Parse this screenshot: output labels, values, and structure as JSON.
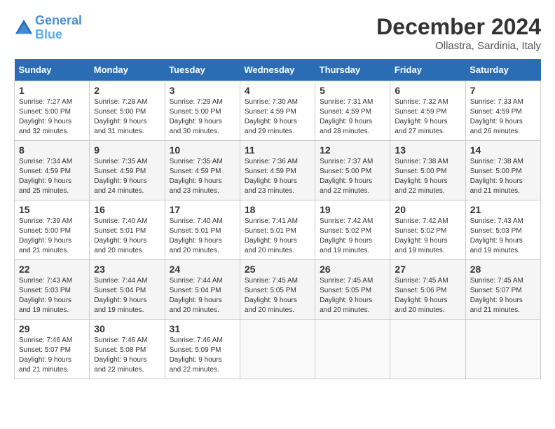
{
  "header": {
    "logo_line1": "General",
    "logo_line2": "Blue",
    "month": "December 2024",
    "location": "Ollastra, Sardinia, Italy"
  },
  "days_of_week": [
    "Sunday",
    "Monday",
    "Tuesday",
    "Wednesday",
    "Thursday",
    "Friday",
    "Saturday"
  ],
  "weeks": [
    [
      {
        "day": "1",
        "info": "Sunrise: 7:27 AM\nSunset: 5:00 PM\nDaylight: 9 hours and 32 minutes."
      },
      {
        "day": "2",
        "info": "Sunrise: 7:28 AM\nSunset: 5:00 PM\nDaylight: 9 hours and 31 minutes."
      },
      {
        "day": "3",
        "info": "Sunrise: 7:29 AM\nSunset: 5:00 PM\nDaylight: 9 hours and 30 minutes."
      },
      {
        "day": "4",
        "info": "Sunrise: 7:30 AM\nSunset: 4:59 PM\nDaylight: 9 hours and 29 minutes."
      },
      {
        "day": "5",
        "info": "Sunrise: 7:31 AM\nSunset: 4:59 PM\nDaylight: 9 hours and 28 minutes."
      },
      {
        "day": "6",
        "info": "Sunrise: 7:32 AM\nSunset: 4:59 PM\nDaylight: 9 hours and 27 minutes."
      },
      {
        "day": "7",
        "info": "Sunrise: 7:33 AM\nSunset: 4:59 PM\nDaylight: 9 hours and 26 minutes."
      }
    ],
    [
      {
        "day": "8",
        "info": "Sunrise: 7:34 AM\nSunset: 4:59 PM\nDaylight: 9 hours and 25 minutes."
      },
      {
        "day": "9",
        "info": "Sunrise: 7:35 AM\nSunset: 4:59 PM\nDaylight: 9 hours and 24 minutes."
      },
      {
        "day": "10",
        "info": "Sunrise: 7:35 AM\nSunset: 4:59 PM\nDaylight: 9 hours and 23 minutes."
      },
      {
        "day": "11",
        "info": "Sunrise: 7:36 AM\nSunset: 4:59 PM\nDaylight: 9 hours and 23 minutes."
      },
      {
        "day": "12",
        "info": "Sunrise: 7:37 AM\nSunset: 5:00 PM\nDaylight: 9 hours and 22 minutes."
      },
      {
        "day": "13",
        "info": "Sunrise: 7:38 AM\nSunset: 5:00 PM\nDaylight: 9 hours and 22 minutes."
      },
      {
        "day": "14",
        "info": "Sunrise: 7:38 AM\nSunset: 5:00 PM\nDaylight: 9 hours and 21 minutes."
      }
    ],
    [
      {
        "day": "15",
        "info": "Sunrise: 7:39 AM\nSunset: 5:00 PM\nDaylight: 9 hours and 21 minutes."
      },
      {
        "day": "16",
        "info": "Sunrise: 7:40 AM\nSunset: 5:01 PM\nDaylight: 9 hours and 20 minutes."
      },
      {
        "day": "17",
        "info": "Sunrise: 7:40 AM\nSunset: 5:01 PM\nDaylight: 9 hours and 20 minutes."
      },
      {
        "day": "18",
        "info": "Sunrise: 7:41 AM\nSunset: 5:01 PM\nDaylight: 9 hours and 20 minutes."
      },
      {
        "day": "19",
        "info": "Sunrise: 7:42 AM\nSunset: 5:02 PM\nDaylight: 9 hours and 19 minutes."
      },
      {
        "day": "20",
        "info": "Sunrise: 7:42 AM\nSunset: 5:02 PM\nDaylight: 9 hours and 19 minutes."
      },
      {
        "day": "21",
        "info": "Sunrise: 7:43 AM\nSunset: 5:03 PM\nDaylight: 9 hours and 19 minutes."
      }
    ],
    [
      {
        "day": "22",
        "info": "Sunrise: 7:43 AM\nSunset: 5:03 PM\nDaylight: 9 hours and 19 minutes."
      },
      {
        "day": "23",
        "info": "Sunrise: 7:44 AM\nSunset: 5:04 PM\nDaylight: 9 hours and 19 minutes."
      },
      {
        "day": "24",
        "info": "Sunrise: 7:44 AM\nSunset: 5:04 PM\nDaylight: 9 hours and 20 minutes."
      },
      {
        "day": "25",
        "info": "Sunrise: 7:45 AM\nSunset: 5:05 PM\nDaylight: 9 hours and 20 minutes."
      },
      {
        "day": "26",
        "info": "Sunrise: 7:45 AM\nSunset: 5:05 PM\nDaylight: 9 hours and 20 minutes."
      },
      {
        "day": "27",
        "info": "Sunrise: 7:45 AM\nSunset: 5:06 PM\nDaylight: 9 hours and 20 minutes."
      },
      {
        "day": "28",
        "info": "Sunrise: 7:45 AM\nSunset: 5:07 PM\nDaylight: 9 hours and 21 minutes."
      }
    ],
    [
      {
        "day": "29",
        "info": "Sunrise: 7:46 AM\nSunset: 5:07 PM\nDaylight: 9 hours and 21 minutes."
      },
      {
        "day": "30",
        "info": "Sunrise: 7:46 AM\nSunset: 5:08 PM\nDaylight: 9 hours and 22 minutes."
      },
      {
        "day": "31",
        "info": "Sunrise: 7:46 AM\nSunset: 5:09 PM\nDaylight: 9 hours and 22 minutes."
      },
      null,
      null,
      null,
      null
    ]
  ]
}
